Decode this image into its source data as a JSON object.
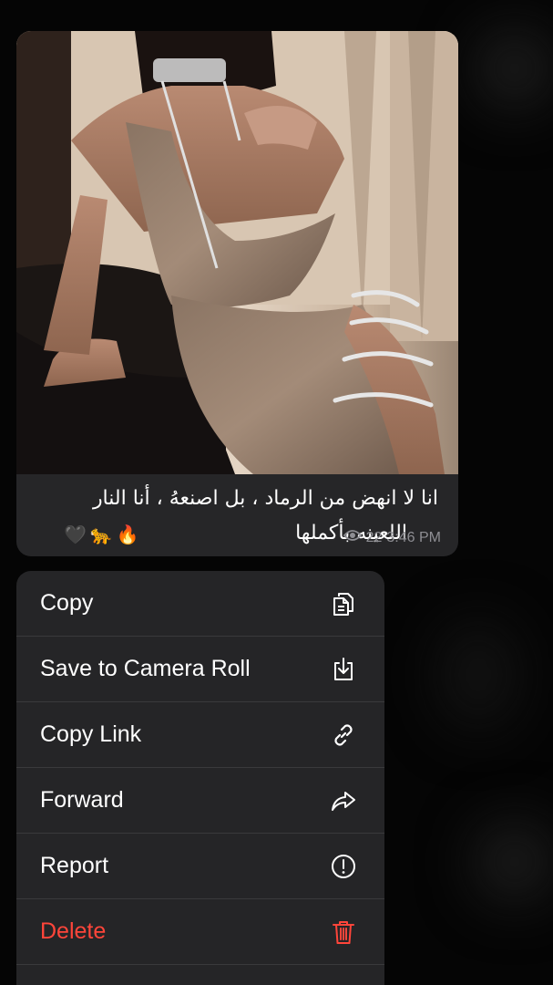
{
  "message": {
    "caption_line1": "انا لا انهض من الرماد ، بل اصنعهُ ، أنا النار",
    "caption_line2": "اللعينه بأكملها",
    "emojis": [
      "🔥",
      "🐆",
      "🖤"
    ],
    "views": "22",
    "time": "3:46 PM"
  },
  "context_menu": {
    "items": [
      {
        "label": "Copy",
        "icon": "copy-icon"
      },
      {
        "label": "Save to Camera Roll",
        "icon": "save-download-icon"
      },
      {
        "label": "Copy Link",
        "icon": "link-icon"
      },
      {
        "label": "Forward",
        "icon": "forward-arrow-icon"
      },
      {
        "label": "Report",
        "icon": "report-exclamation-icon"
      },
      {
        "label": "Delete",
        "icon": "trash-icon"
      }
    ]
  },
  "colors": {
    "background": "#050505",
    "bubble": "#262628",
    "menu": "#252527",
    "text": "#ffffff",
    "meta": "#8e8e93",
    "danger": "#ff453a"
  }
}
